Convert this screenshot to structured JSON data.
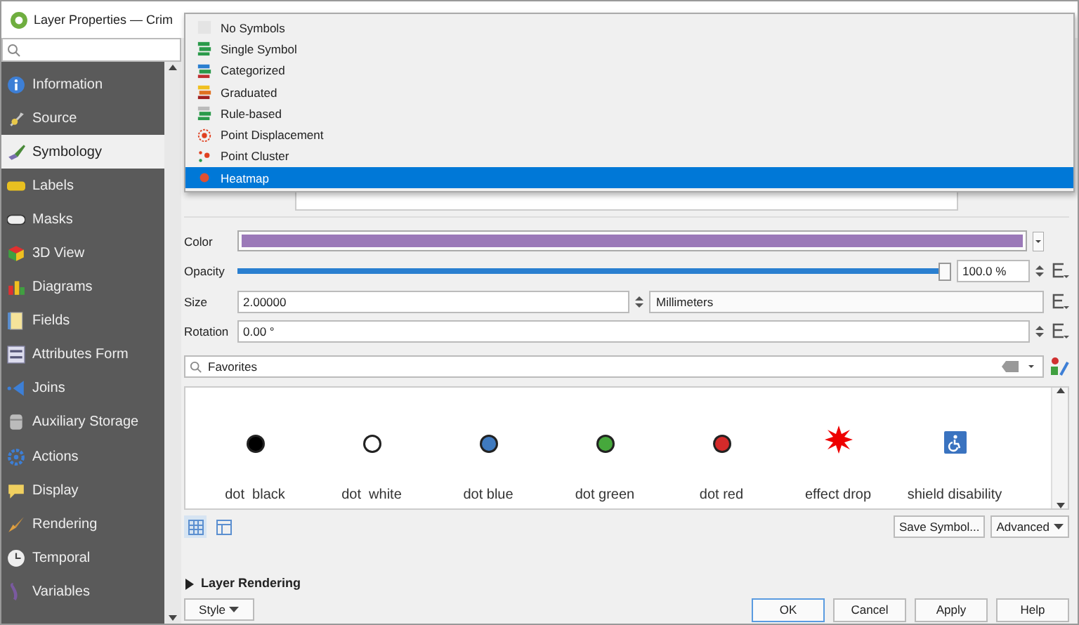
{
  "window": {
    "title": "Layer Properties — Crim"
  },
  "sidebar": {
    "items": [
      {
        "label": "Information",
        "selected": false
      },
      {
        "label": "Source",
        "selected": false
      },
      {
        "label": "Symbology",
        "selected": true
      },
      {
        "label": "Labels",
        "selected": false
      },
      {
        "label": "Masks",
        "selected": false
      },
      {
        "label": "3D View",
        "selected": false
      },
      {
        "label": "Diagrams",
        "selected": false
      },
      {
        "label": "Fields",
        "selected": false
      },
      {
        "label": "Attributes Form",
        "selected": false
      },
      {
        "label": "Joins",
        "selected": false
      },
      {
        "label": "Auxiliary Storage",
        "selected": false
      },
      {
        "label": "Actions",
        "selected": false
      },
      {
        "label": "Display",
        "selected": false
      },
      {
        "label": "Rendering",
        "selected": false
      },
      {
        "label": "Temporal",
        "selected": false
      },
      {
        "label": "Variables",
        "selected": false
      }
    ]
  },
  "renderer_menu": {
    "items": [
      {
        "label": "No Symbols",
        "selected": false
      },
      {
        "label": "Single Symbol",
        "selected": false
      },
      {
        "label": "Categorized",
        "selected": false
      },
      {
        "label": "Graduated",
        "selected": false
      },
      {
        "label": "Rule-based",
        "selected": false
      },
      {
        "label": "Point Displacement",
        "selected": false
      },
      {
        "label": "Point Cluster",
        "selected": false
      },
      {
        "label": "Heatmap",
        "selected": true
      }
    ]
  },
  "properties": {
    "color": {
      "label": "Color",
      "color": "#9b79b8"
    },
    "opacity": {
      "label": "Opacity",
      "level": 1.0,
      "reading": "100.0 %"
    },
    "size": {
      "label": "Size",
      "value": "2.00000",
      "unit": "Millimeters"
    },
    "rotation": {
      "label": "Rotation",
      "value": "0.00 °"
    }
  },
  "symbol_search": {
    "value": "Favorites"
  },
  "symbols": [
    {
      "name": "dot  black",
      "kind": "dot",
      "color": "#000000"
    },
    {
      "name": "dot  white",
      "kind": "dot",
      "color": "#ffffff"
    },
    {
      "name": "dot blue",
      "kind": "dot",
      "color": "#3f7abf"
    },
    {
      "name": "dot green",
      "kind": "dot",
      "color": "#46a83c"
    },
    {
      "name": "dot red",
      "kind": "dot",
      "color": "#d42a2a"
    },
    {
      "name": "effect drop",
      "kind": "star",
      "color": "#ee0000"
    },
    {
      "name": "shield disability",
      "kind": "shield",
      "color": "#3a73c0"
    }
  ],
  "symbol_buttons": [
    "Save Symbol...",
    "Advanced"
  ],
  "layer_rendering": {
    "label": "Layer Rendering",
    "expanded": false
  },
  "style_button": "Style",
  "dialog_buttons": [
    {
      "label": "OK",
      "default": true
    },
    {
      "label": "Cancel",
      "default": false
    },
    {
      "label": "Apply",
      "default": false
    },
    {
      "label": "Help",
      "default": false
    }
  ]
}
